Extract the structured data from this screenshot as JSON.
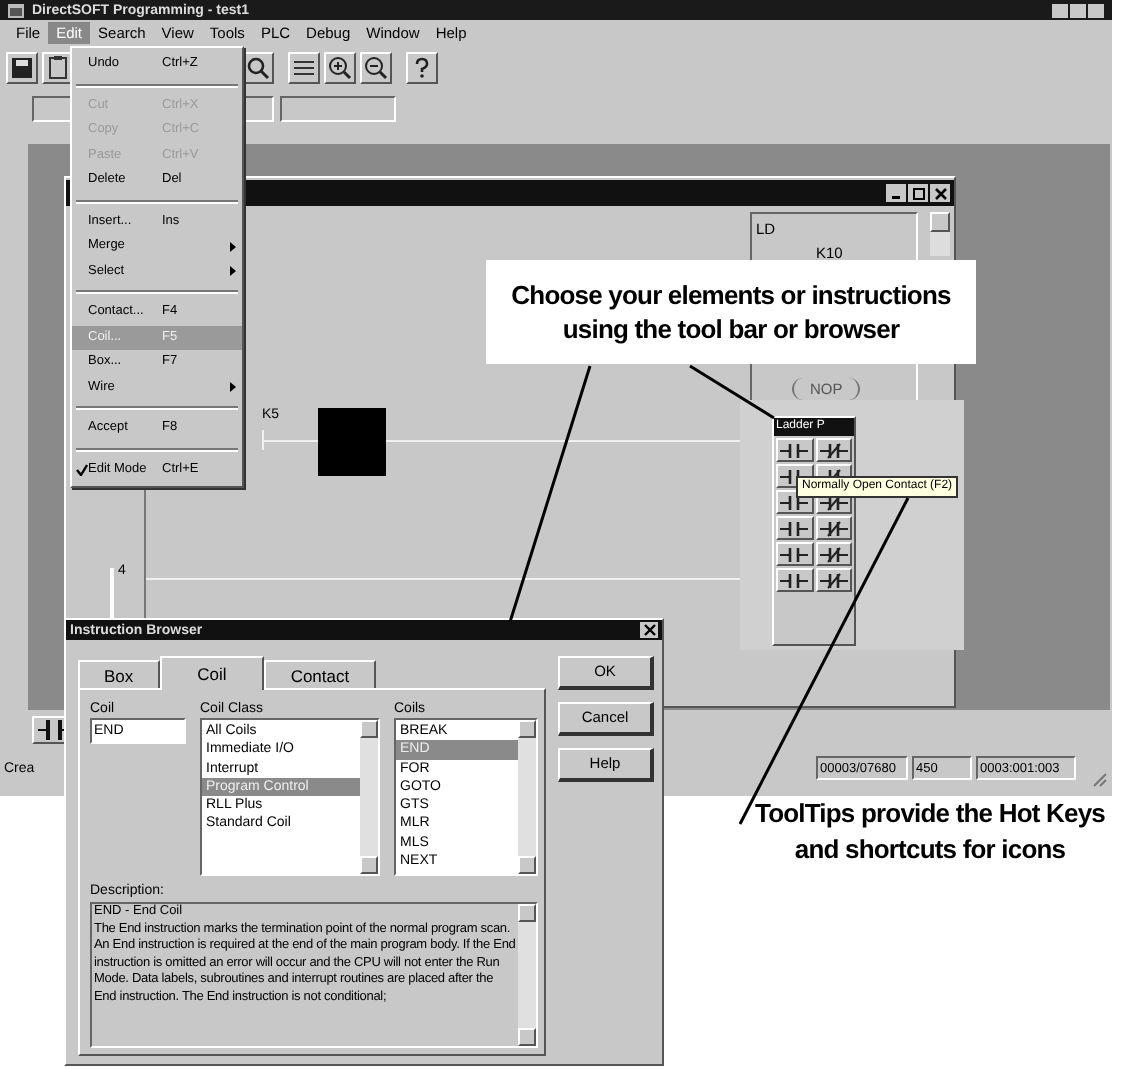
{
  "window": {
    "title": "DirectSOFT Programming - test1"
  },
  "menu_bar": [
    {
      "label": "File",
      "selected": false
    },
    {
      "label": "Edit",
      "selected": true
    },
    {
      "label": "Search",
      "selected": false
    },
    {
      "label": "View",
      "selected": false
    },
    {
      "label": "Tools",
      "selected": false
    },
    {
      "label": "PLC",
      "selected": false
    },
    {
      "label": "Debug",
      "selected": false
    },
    {
      "label": "Window",
      "selected": false
    },
    {
      "label": "Help",
      "selected": false
    }
  ],
  "edit_menu": [
    {
      "kind": "item",
      "label": "Undo",
      "shortcut": "Ctrl+Z",
      "disabled": false,
      "selected": false,
      "checked": false
    },
    {
      "kind": "separator"
    },
    {
      "kind": "item",
      "label": "Cut",
      "shortcut": "Ctrl+X",
      "disabled": true,
      "selected": false,
      "checked": false
    },
    {
      "kind": "item",
      "label": "Copy",
      "shortcut": "Ctrl+C",
      "disabled": true,
      "selected": false,
      "checked": false
    },
    {
      "kind": "item",
      "label": "Paste",
      "shortcut": "Ctrl+V",
      "disabled": true,
      "selected": false,
      "checked": false
    },
    {
      "kind": "item",
      "label": "Delete",
      "shortcut": "Del",
      "disabled": false,
      "selected": false,
      "checked": false
    },
    {
      "kind": "separator"
    },
    {
      "kind": "item",
      "label": "Insert...",
      "shortcut": "Ins",
      "disabled": false,
      "selected": false,
      "checked": false
    },
    {
      "kind": "submenu",
      "label": "Merge"
    },
    {
      "kind": "submenu",
      "label": "Select"
    },
    {
      "kind": "separator"
    },
    {
      "kind": "item",
      "label": "Contact...",
      "shortcut": "F4",
      "disabled": false,
      "selected": false,
      "checked": false
    },
    {
      "kind": "item",
      "label": "Coil...",
      "shortcut": "F5",
      "disabled": false,
      "selected": true,
      "checked": false
    },
    {
      "kind": "item",
      "label": "Box...",
      "shortcut": "F7",
      "disabled": false,
      "selected": false,
      "checked": false
    },
    {
      "kind": "submenu",
      "label": "Wire"
    },
    {
      "kind": "separator"
    },
    {
      "kind": "item",
      "label": "Accept",
      "shortcut": "F8",
      "disabled": false,
      "selected": false,
      "checked": false
    },
    {
      "kind": "separator"
    },
    {
      "kind": "item",
      "label": "Edit Mode",
      "shortcut": "Ctrl+E",
      "disabled": false,
      "selected": false,
      "checked": true
    }
  ],
  "ladder_window": {
    "instruction_panel": [
      "LD",
      "K10"
    ],
    "coil": "NOP",
    "rung_contact": "K5",
    "rung_number": "4"
  },
  "ladder_palette": {
    "title": "Ladder P",
    "tooltip": "Normally Open Contact (F2)"
  },
  "status_bar": {
    "message": "Crea",
    "fields": [
      "00003/07680",
      "450",
      "0003:001:003"
    ]
  },
  "instruction_browser": {
    "title": "Instruction Browser",
    "tabs": [
      {
        "label": "Box",
        "selected": false
      },
      {
        "label": "Coil",
        "selected": true
      },
      {
        "label": "Contact",
        "selected": false
      }
    ],
    "buttons": [
      "OK",
      "Cancel",
      "Help"
    ],
    "coil_label": "Coil",
    "coil_value": "END",
    "class_label": "Coil Class",
    "classes": [
      {
        "label": "All Coils",
        "selected": false
      },
      {
        "label": "Immediate I/O",
        "selected": false
      },
      {
        "label": "Interrupt",
        "selected": false
      },
      {
        "label": "Program Control",
        "selected": true
      },
      {
        "label": "RLL Plus",
        "selected": false
      },
      {
        "label": "Standard Coil",
        "selected": false
      }
    ],
    "coils_label": "Coils",
    "coils": [
      {
        "label": "BREAK",
        "selected": false
      },
      {
        "label": "END",
        "selected": true
      },
      {
        "label": "FOR",
        "selected": false
      },
      {
        "label": "GOTO",
        "selected": false
      },
      {
        "label": "GTS",
        "selected": false
      },
      {
        "label": "MLR",
        "selected": false
      },
      {
        "label": "MLS",
        "selected": false
      },
      {
        "label": "NEXT",
        "selected": false
      }
    ],
    "description_label": "Description:",
    "description_title": "END - End Coil",
    "description": "The End instruction marks the termination point of the normal program scan. An End instruction is required at the end of the main program body. If the End instruction is omitted an error will occur and the CPU will not enter the Run Mode. Data labels, subroutines and interrupt routines are placed after the End instruction. The End instruction is not conditional;"
  },
  "callouts": [
    "Choose your elements or instructions using the tool bar or browser",
    "ToolTips provide the Hot Keys and shortcuts for icons"
  ]
}
